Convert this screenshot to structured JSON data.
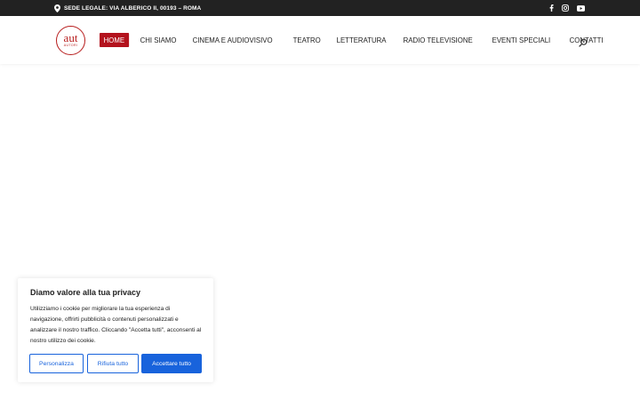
{
  "topbar": {
    "address": "SEDE LEGALE: VIA ALBERICO II, 00193 – ROMA",
    "background": "#222222",
    "icons": [
      "location-pin-icon",
      "facebook-icon",
      "instagram-icon",
      "youtube-icon"
    ]
  },
  "logo": {
    "big": "aut",
    "small": "AUTORI"
  },
  "nav": {
    "items": [
      "HOME",
      "CHI SIAMO",
      "CINEMA E AUDIOVISIVO",
      "TEATRO",
      "LETTERATURA",
      "RADIO TELEVISIONE",
      "EVENTI SPECIALI",
      "CONTATTI"
    ],
    "active_color": "#b3121d",
    "search_icon": "search-icon"
  },
  "cookie_banner": {
    "title": "Diamo valore alla tua privacy",
    "text": "Utilizziamo i cookie per migliorare la tua esperienza di navigazione, offrirti pubblicità o contenuti personalizzati e analizzare il nostro traffico. Cliccando \"Accetta tutti\", acconsenti al nostro utilizzo dei cookie.",
    "buttons": {
      "customize": "Personalizza",
      "reject": "Rifiuta tutto",
      "accept": "Accettare tutto"
    },
    "accent": "#1863dc"
  }
}
